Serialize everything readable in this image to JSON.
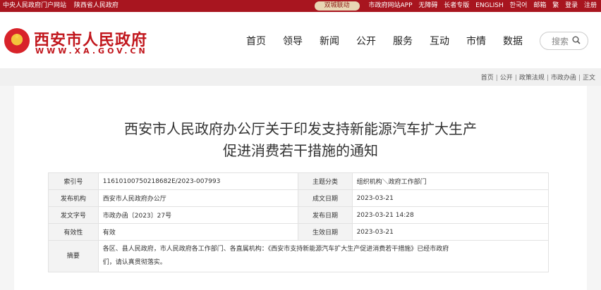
{
  "topbar": {
    "links": [
      "中央人民政府门户网站",
      "陕西省人民政府"
    ],
    "pill": "双城联动",
    "right_links": [
      "市政府网站APP",
      "无障碍",
      "长者专版",
      "ENGLISH",
      "한국어",
      "邮箱",
      "繁",
      "登录",
      "注册"
    ]
  },
  "header": {
    "site_name": "西安市人民政府",
    "site_url": "WWW.XA.GOV.CN",
    "nav": [
      "首页",
      "领导",
      "新闻",
      "公开",
      "服务",
      "互动",
      "市情",
      "数据"
    ],
    "search_placeholder": "搜索"
  },
  "breadcrumb": [
    "首页",
    "公开",
    "政策法规",
    "市政办函",
    "正文"
  ],
  "article": {
    "title_line1": "西安市人民政府办公厅关于印发支持新能源汽车扩大生产",
    "title_line2": "促进消费若干措施的通知"
  },
  "meta": {
    "rows": [
      [
        "索引号",
        "11610100750218682E/2023-007993",
        "主题分类",
        "组织机构＼政府工作部门"
      ],
      [
        "发布机构",
        "西安市人民政府办公厅",
        "成文日期",
        "2023-03-21"
      ],
      [
        "发文字号",
        "市政办函〔2023〕27号",
        "发布日期",
        "2023-03-21 14:28"
      ],
      [
        "有效性",
        "有效",
        "生效日期",
        "2023-03-21"
      ]
    ],
    "summary_label": "摘要",
    "summary_line1": "各区、县人民政府，市人民政府各工作部门、各直属机构：《西安市支持新能源汽车扩大生产促进消费若干措施》已经市政府",
    "summary_line2": "们，请认真贯彻落实。"
  },
  "colors": {
    "brand_red": "#a8151f",
    "title_red": "#c1161c",
    "pill_gold": "#e8d6b4"
  }
}
